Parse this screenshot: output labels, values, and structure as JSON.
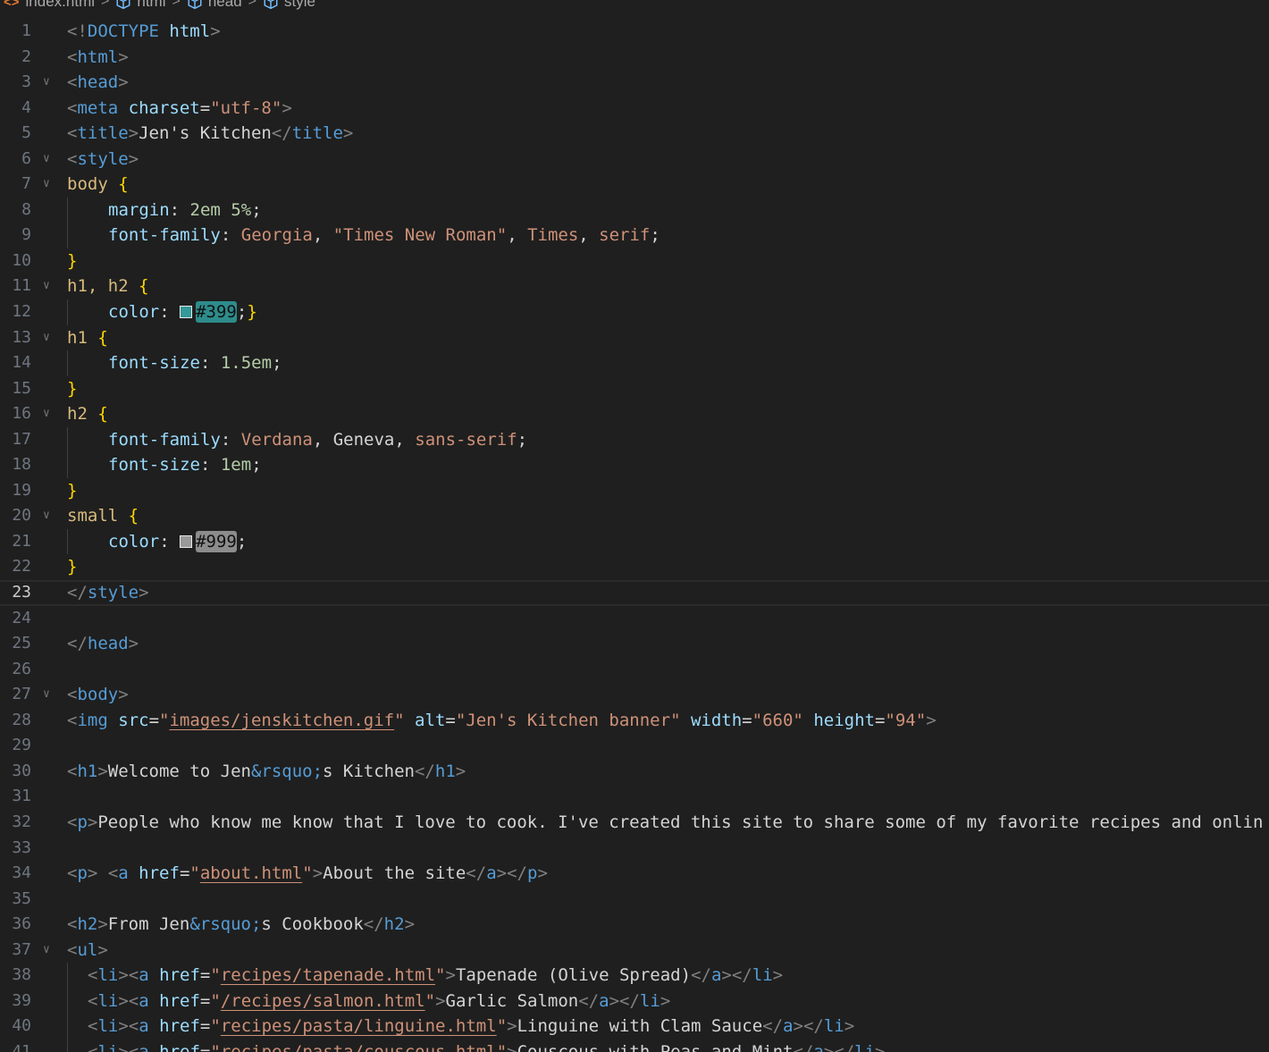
{
  "breadcrumb": {
    "items": [
      {
        "label": "index.html",
        "icon": "html-file-icon"
      },
      {
        "label": "html",
        "icon": "symbol-element-icon"
      },
      {
        "label": "head",
        "icon": "symbol-element-icon"
      },
      {
        "label": "style",
        "icon": "symbol-element-icon"
      }
    ]
  },
  "editor": {
    "current_line": 23,
    "colors": {
      "background": "#1f1f1f",
      "swatch_399": "#339999",
      "swatch_999": "#999999"
    },
    "lines": [
      {
        "n": "1",
        "code": "<!DOCTYPE html>"
      },
      {
        "n": "2",
        "code": "<html>"
      },
      {
        "n": "3",
        "code": "<head>"
      },
      {
        "n": "4",
        "code": "<meta charset=\"utf-8\">"
      },
      {
        "n": "5",
        "code": "<title>Jen's Kitchen</title>"
      },
      {
        "n": "6",
        "code": "<style>"
      },
      {
        "n": "7",
        "code": "body {"
      },
      {
        "n": "8",
        "code": "    margin: 2em 5%;"
      },
      {
        "n": "9",
        "code": "    font-family: Georgia, \"Times New Roman\", Times, serif;"
      },
      {
        "n": "10",
        "code": "}"
      },
      {
        "n": "11",
        "code": "h1, h2 {"
      },
      {
        "n": "12",
        "code": "    color: #399;}"
      },
      {
        "n": "13",
        "code": "h1 {"
      },
      {
        "n": "14",
        "code": "    font-size: 1.5em;"
      },
      {
        "n": "15",
        "code": "}"
      },
      {
        "n": "16",
        "code": "h2 {"
      },
      {
        "n": "17",
        "code": "    font-family: Verdana, Geneva, sans-serif;"
      },
      {
        "n": "18",
        "code": "    font-size: 1em;"
      },
      {
        "n": "19",
        "code": "}"
      },
      {
        "n": "20",
        "code": "small {"
      },
      {
        "n": "21",
        "code": "    color: #999;"
      },
      {
        "n": "22",
        "code": "}"
      },
      {
        "n": "23",
        "code": "</style>"
      },
      {
        "n": "24",
        "code": ""
      },
      {
        "n": "25",
        "code": "</head>"
      },
      {
        "n": "26",
        "code": ""
      },
      {
        "n": "27",
        "code": "<body>"
      },
      {
        "n": "28",
        "code": "<img src=\"images/jenskitchen.gif\" alt=\"Jen's Kitchen banner\" width=\"660\" height=\"94\">"
      },
      {
        "n": "29",
        "code": ""
      },
      {
        "n": "30",
        "code": "<h1>Welcome to Jen&rsquo;s Kitchen</h1>"
      },
      {
        "n": "31",
        "code": ""
      },
      {
        "n": "32",
        "code": "<p>People who know me know that I love to cook. I've created this site to share some of my favorite recipes and onlin"
      },
      {
        "n": "33",
        "code": ""
      },
      {
        "n": "34",
        "code": "<p> <a href=\"about.html\">About the site</a></p>"
      },
      {
        "n": "35",
        "code": ""
      },
      {
        "n": "36",
        "code": "<h2>From Jen&rsquo;s Cookbook</h2>"
      },
      {
        "n": "37",
        "code": "<ul>"
      },
      {
        "n": "38",
        "code": "  <li><a href=\"recipes/tapenade.html\">Tapenade (Olive Spread)</a></li>"
      },
      {
        "n": "39",
        "code": "  <li><a href=\"/recipes/salmon.html\">Garlic Salmon</a></li>"
      },
      {
        "n": "40",
        "code": "  <li><a href=\"recipes/pasta/linguine.html\">Linguine with Clam Sauce</a></li>"
      },
      {
        "n": "41",
        "code": "  <li><a href=\"recipes/pasta/couscous.html\">Couscous with Peas and Mint</a></li>"
      }
    ]
  }
}
